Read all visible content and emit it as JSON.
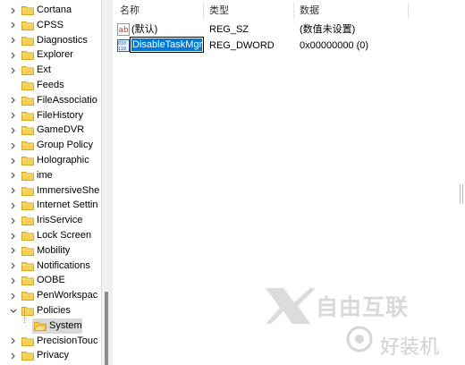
{
  "tree": {
    "items": [
      {
        "label": "Cortana",
        "expandable": true
      },
      {
        "label": "CPSS",
        "expandable": true
      },
      {
        "label": "Diagnostics",
        "expandable": true
      },
      {
        "label": "Explorer",
        "expandable": true
      },
      {
        "label": "Ext",
        "expandable": true
      },
      {
        "label": "Feeds",
        "expandable": false
      },
      {
        "label": "FileAssociatio",
        "expandable": true
      },
      {
        "label": "FileHistory",
        "expandable": true
      },
      {
        "label": "GameDVR",
        "expandable": true
      },
      {
        "label": "Group Policy",
        "expandable": true
      },
      {
        "label": "Holographic",
        "expandable": true
      },
      {
        "label": "ime",
        "expandable": true
      },
      {
        "label": "ImmersiveShe",
        "expandable": true
      },
      {
        "label": "Internet Settin",
        "expandable": true
      },
      {
        "label": "IrisService",
        "expandable": true
      },
      {
        "label": "Lock Screen",
        "expandable": true
      },
      {
        "label": "Mobility",
        "expandable": true
      },
      {
        "label": "Notifications",
        "expandable": true
      },
      {
        "label": "OOBE",
        "expandable": true
      },
      {
        "label": "PenWorkspac",
        "expandable": true
      },
      {
        "label": "Policies",
        "expandable": true,
        "expanded": true
      },
      {
        "label": "System",
        "child": true,
        "selected": true
      },
      {
        "label": "PrecisionTouc",
        "expandable": true
      },
      {
        "label": "Privacy",
        "expandable": true
      }
    ]
  },
  "list": {
    "headers": {
      "name": "名称",
      "type": "类型",
      "data": "数据"
    },
    "rows": [
      {
        "name": "(默认)",
        "type": "REG_SZ",
        "data": "(数值未设置)",
        "icon": "string-value-icon"
      },
      {
        "name": "DisableTaskMgr",
        "type": "REG_DWORD",
        "data": "0x00000000 (0)",
        "icon": "binary-value-icon",
        "editing": true
      }
    ]
  },
  "watermark": {
    "brand": "自由互联",
    "sub": "好装机"
  },
  "colors": {
    "folder": "#f6cf56",
    "selection": "#0078d7",
    "selected_bg": "#d9d9d9"
  }
}
